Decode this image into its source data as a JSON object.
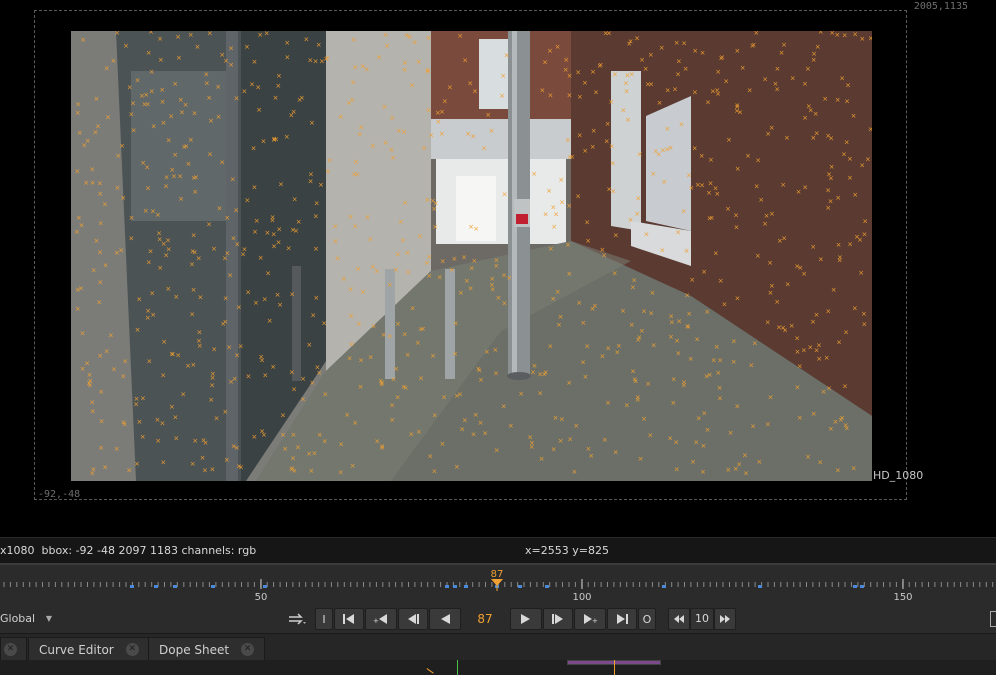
{
  "viewer": {
    "bbox_top_right": "2005,1135",
    "bbox_bottom_left": "-92,-48",
    "format_label": "HD_1080",
    "tracker_marker_color": "#f0a030"
  },
  "info_bar": {
    "left_text": "x1080  bbox: -92 -48 2097 1183 channels: rgb",
    "cursor_text": "x=2553 y=825"
  },
  "timeline": {
    "current_frame": "87",
    "tick_labels": [
      "50",
      "100",
      "150"
    ],
    "playhead_color": "#f0a030"
  },
  "transport": {
    "scope_select": "Global",
    "frame_value": "87",
    "step_value": "10",
    "buttons": [
      "loop-mode",
      "in-point",
      "goto-start",
      "back-keyframe",
      "prev-frame",
      "play-backward",
      "play-forward",
      "next-frame",
      "forward-keyframe",
      "goto-end",
      "out-point",
      "step-back",
      "step-forward"
    ],
    "out_point_label": "O",
    "in_point_label": "I"
  },
  "tabs": [
    {
      "label": "Curve Editor"
    },
    {
      "label": "Dope Sheet"
    }
  ]
}
